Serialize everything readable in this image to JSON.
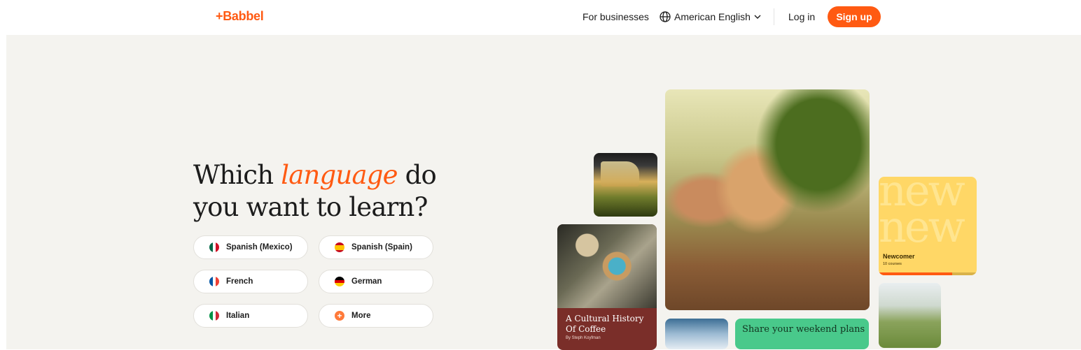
{
  "header": {
    "logo": "+Babbel",
    "for_businesses": "For businesses",
    "language_selector": "American English",
    "login": "Log in",
    "signup": "Sign up"
  },
  "hero": {
    "headline_pre": "Which ",
    "headline_accent": "language",
    "headline_post": " do you want to learn?",
    "languages": [
      {
        "label": "Spanish (Mexico)",
        "flag": "mexico-flag-icon"
      },
      {
        "label": "Spanish (Spain)",
        "flag": "spain-flag-icon"
      },
      {
        "label": "French",
        "flag": "france-flag-icon"
      },
      {
        "label": "German",
        "flag": "germany-flag-icon"
      },
      {
        "label": "Italian",
        "flag": "italy-flag-icon"
      },
      {
        "label": "More",
        "flag": "plus-icon"
      }
    ]
  },
  "collage": {
    "coffee_title": "A Cultural History Of Coffee",
    "coffee_author": "By Steph Koyfman",
    "newcomer_bg": "new new",
    "newcomer_label": "Newcomer",
    "newcomer_sub": "10 courses",
    "newcomer_progress": 0.75,
    "plans_text": "Share your weekend plans"
  },
  "colors": {
    "accent": "#ff5a12",
    "hero_bg": "#f4f3ef",
    "newcomer_bg": "#ffd766",
    "plans_bg": "#49c98b",
    "coffee_bg": "#7a2e29"
  }
}
